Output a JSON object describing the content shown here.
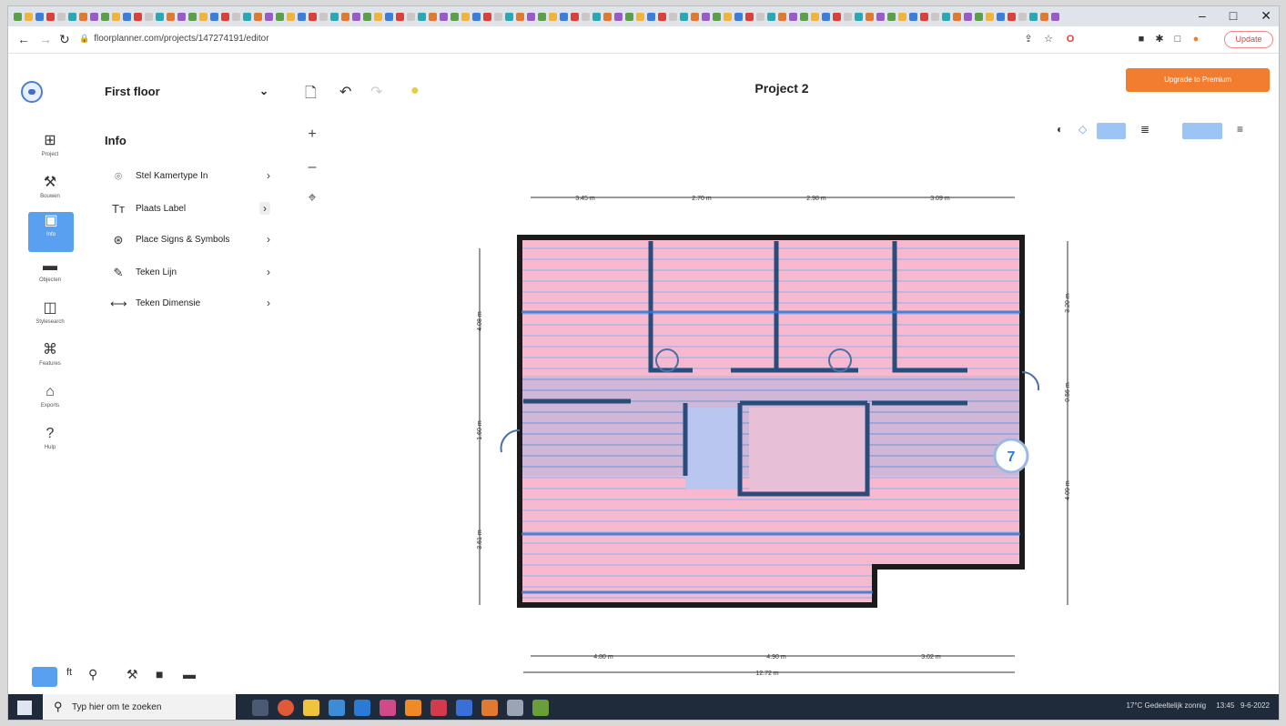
{
  "browser": {
    "url": "floorplanner.com/projects/147274191/editor",
    "profile_label": "Update"
  },
  "app": {
    "floor_name": "First floor",
    "floor_chevron": "⌄",
    "project_title": "Project 2",
    "upgrade_label": "Upgrade to Premium"
  },
  "sidebar": {
    "items": [
      {
        "label": "Project",
        "icon": "floorplan-icon"
      },
      {
        "label": "Bouwen",
        "icon": "tools-icon"
      },
      {
        "label": "Info",
        "icon": "info-icon"
      },
      {
        "label": "Objecten",
        "icon": "sofa-icon"
      },
      {
        "label": "Stylesearch",
        "icon": "style-icon"
      },
      {
        "label": "Features",
        "icon": "features-icon"
      },
      {
        "label": "Exports",
        "icon": "export-icon"
      },
      {
        "label": "Hulp",
        "icon": "help-icon"
      }
    ]
  },
  "panel": {
    "title": "Info",
    "items": [
      {
        "label": "Stel Kamertype In",
        "icon": "room-type-icon"
      },
      {
        "label": "Plaats Label",
        "icon": "text-label-icon"
      },
      {
        "label": "Place Signs & Symbols",
        "icon": "symbols-icon"
      },
      {
        "label": "Teken Lijn",
        "icon": "draw-line-icon"
      },
      {
        "label": "Teken Dimensie",
        "icon": "dimension-icon"
      }
    ]
  },
  "dimensions": {
    "top": [
      "3.45 m",
      "2.70 m",
      "2.98 m",
      "3.09 m"
    ],
    "left": [
      "4.08 m",
      "1.60 m",
      "3.61 m"
    ],
    "right": [
      "3.20 m",
      "0.56 m",
      "4.09 m"
    ],
    "bottom_parts": [
      "4.80 m",
      "4.90 m",
      "3.02 m"
    ],
    "bottom_total": "12.72 m"
  },
  "badge_number": "7",
  "taskbar": {
    "search_placeholder": "Typ hier om te zoeken",
    "weather": "17°C  Gedeeltelijk zonnig",
    "time": "13:45",
    "date": "9-6-2022"
  },
  "colors": {
    "accent": "#f37d2e",
    "active_blue": "#5aa0f0",
    "wall": "#1b1b1b",
    "room_pink": "#f6b9cf",
    "blue_line": "#2d78d6"
  }
}
